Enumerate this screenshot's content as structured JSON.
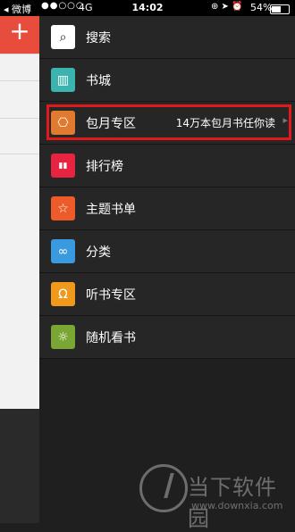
{
  "status_bar": {
    "back_label": "◂ 微博",
    "signal_dots": "●●○○○",
    "network": "4G",
    "time": "14:02",
    "status_icons": "⊕ ➤ ⏰",
    "battery": "54%"
  },
  "background_app": {
    "add_label": "+"
  },
  "menu": {
    "items": [
      {
        "label": "搜索",
        "icon": "search-icon",
        "color": "#ffffff",
        "glyph": "⌕"
      },
      {
        "label": "书城",
        "icon": "bookstore-icon",
        "color": "#3bb4b0",
        "glyph": "▥"
      },
      {
        "label": "包月专区",
        "icon": "monthly-icon",
        "color": "#e07a2e",
        "glyph": "⎔",
        "right_text": "14万本包月书任你读"
      },
      {
        "label": "排行榜",
        "icon": "ranking-icon",
        "color": "#e8233f",
        "glyph": "▮▮"
      },
      {
        "label": "主题书单",
        "icon": "star-icon",
        "color": "#ee5b2b",
        "glyph": "☆"
      },
      {
        "label": "分类",
        "icon": "category-icon",
        "color": "#3a9ae0",
        "glyph": "∞"
      },
      {
        "label": "听书专区",
        "icon": "headphones-icon",
        "color": "#f09a1d",
        "glyph": "Ω"
      },
      {
        "label": "随机看书",
        "icon": "bulb-icon",
        "color": "#7aa633",
        "glyph": "☼"
      }
    ]
  },
  "watermark": {
    "text": "当下软件园",
    "url": "www.downxia.com"
  }
}
